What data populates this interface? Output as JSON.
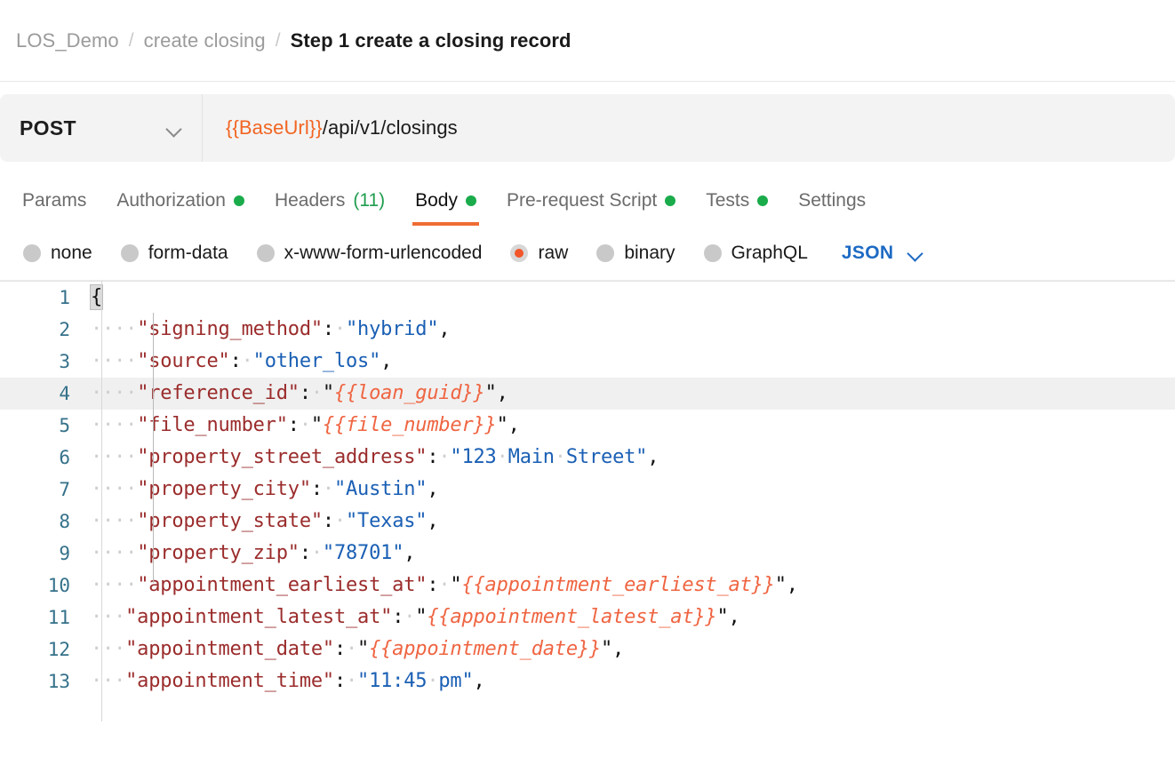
{
  "breadcrumb": {
    "items": [
      {
        "label": "LOS_Demo",
        "current": false
      },
      {
        "label": "create closing",
        "current": false
      },
      {
        "label": "Step 1 create a closing record",
        "current": true
      }
    ],
    "separator": "/"
  },
  "request": {
    "method": "POST",
    "method_chevron_icon": "chevron-down-icon",
    "url_variable": "{{BaseUrl}}",
    "url_path": "/api/v1/closings"
  },
  "tabs": [
    {
      "label": "Params",
      "indicator": "",
      "active": false
    },
    {
      "label": "Authorization",
      "indicator": "dot",
      "active": false
    },
    {
      "label": "Headers",
      "indicator": "count",
      "count": "(11)",
      "active": false
    },
    {
      "label": "Body",
      "indicator": "dot",
      "active": true
    },
    {
      "label": "Pre-request Script",
      "indicator": "dot",
      "active": false
    },
    {
      "label": "Tests",
      "indicator": "dot",
      "active": false
    },
    {
      "label": "Settings",
      "indicator": "",
      "active": false
    }
  ],
  "body_types": [
    {
      "label": "none",
      "selected": false
    },
    {
      "label": "form-data",
      "selected": false
    },
    {
      "label": "x-www-form-urlencoded",
      "selected": false
    },
    {
      "label": "raw",
      "selected": true
    },
    {
      "label": "binary",
      "selected": false
    },
    {
      "label": "GraphQL",
      "selected": false
    }
  ],
  "raw_format": {
    "label": "JSON",
    "chevron_icon": "chevron-down-icon"
  },
  "colors": {
    "accent_orange": "#ef6c33",
    "variable_orange": "#f26522",
    "status_green": "#1aab4b",
    "link_blue": "#1d6ac4",
    "json_key": "#9b2c2c",
    "json_string": "#1a5fb4",
    "line_number": "#35718a"
  },
  "editor": {
    "lines": [
      {
        "num": "1",
        "indent": "",
        "key": "",
        "value": "",
        "text": "{",
        "highlight": false
      },
      {
        "num": "2",
        "indent": "····",
        "key": "\"signing_method\"",
        "value": "\"hybrid\"",
        "highlight": false
      },
      {
        "num": "3",
        "indent": "····",
        "key": "\"source\"",
        "value": "\"other_los\"",
        "highlight": false
      },
      {
        "num": "4",
        "indent": "····",
        "key": "\"reference_id\"",
        "value": "{{loan_guid}}",
        "variable": true,
        "highlight": true
      },
      {
        "num": "5",
        "indent": "····",
        "key": "\"file_number\"",
        "value": "{{file_number}}",
        "variable": true,
        "highlight": false
      },
      {
        "num": "6",
        "indent": "····",
        "key": "\"property_street_address\"",
        "value": "\"123 Main Street\"",
        "highlight": false
      },
      {
        "num": "7",
        "indent": "····",
        "key": "\"property_city\"",
        "value": "\"Austin\"",
        "highlight": false
      },
      {
        "num": "8",
        "indent": "····",
        "key": "\"property_state\"",
        "value": "\"Texas\"",
        "highlight": false
      },
      {
        "num": "9",
        "indent": "····",
        "key": "\"property_zip\"",
        "value": "\"78701\"",
        "highlight": false
      },
      {
        "num": "10",
        "indent": "····",
        "key": "\"appointment_earliest_at\"",
        "value": "{{appointment_earliest_at}}",
        "variable": true,
        "highlight": false
      },
      {
        "num": "11",
        "indent": "···",
        "key": "\"appointment_latest_at\"",
        "value": "{{appointment_latest_at}}",
        "variable": true,
        "highlight": false
      },
      {
        "num": "12",
        "indent": "···",
        "key": "\"appointment_date\"",
        "value": "{{appointment_date}}",
        "variable": true,
        "highlight": false
      },
      {
        "num": "13",
        "indent": "···",
        "key": "\"appointment_time\"",
        "value": "\"11:45 pm\"",
        "highlight": false
      }
    ]
  }
}
